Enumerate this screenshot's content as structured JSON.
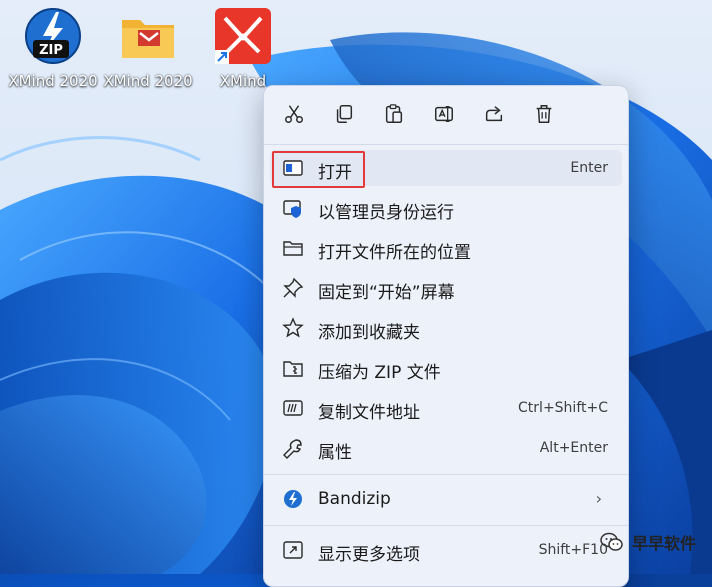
{
  "desktop": {
    "icons": [
      {
        "label": "XMind 2020",
        "icon": "zip-archive-icon"
      },
      {
        "label": "XMind 2020",
        "icon": "folder-icon"
      },
      {
        "label": "XMind",
        "icon": "xmind-app-icon"
      }
    ]
  },
  "menu": {
    "toolbar": [
      {
        "name": "cut",
        "icon": "scissors-icon"
      },
      {
        "name": "copy",
        "icon": "copy-icon"
      },
      {
        "name": "paste",
        "icon": "paste-icon"
      },
      {
        "name": "rename",
        "icon": "rename-icon"
      },
      {
        "name": "share",
        "icon": "share-icon"
      },
      {
        "name": "delete",
        "icon": "trash-icon"
      }
    ],
    "items": [
      {
        "label": "打开",
        "shortcut": "Enter",
        "icon": "open-window-icon"
      },
      {
        "label": "以管理员身份运行",
        "shortcut": "",
        "icon": "admin-shield-icon"
      },
      {
        "label": "打开文件所在的位置",
        "shortcut": "",
        "icon": "folder-icon"
      },
      {
        "label": "固定到“开始”屏幕",
        "shortcut": "",
        "icon": "pin-icon"
      },
      {
        "label": "添加到收藏夹",
        "shortcut": "",
        "icon": "star-icon"
      },
      {
        "label": "压缩为 ZIP 文件",
        "shortcut": "",
        "icon": "zip-folder-icon"
      },
      {
        "label": "复制文件地址",
        "shortcut": "Ctrl+Shift+C",
        "icon": "copy-path-icon"
      },
      {
        "label": "属性",
        "shortcut": "Alt+Enter",
        "icon": "wrench-icon"
      },
      {
        "label": "Bandizip",
        "shortcut": "",
        "icon": "bandizip-icon"
      },
      {
        "label": "显示更多选项",
        "shortcut": "Shift+F10",
        "icon": "more-options-icon"
      }
    ],
    "highlight_color": "#e23a3a"
  },
  "watermark": {
    "text": "早早软件",
    "icon": "wechat-icon"
  }
}
